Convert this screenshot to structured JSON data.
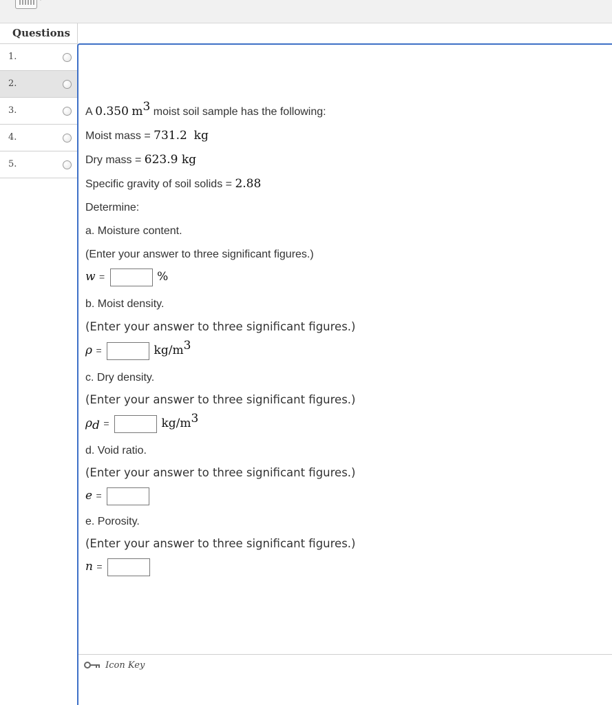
{
  "sidebar": {
    "header": "Questions",
    "items": [
      {
        "label": "1."
      },
      {
        "label": "2."
      },
      {
        "label": "3."
      },
      {
        "label": "4."
      },
      {
        "label": "5."
      }
    ]
  },
  "problem": {
    "intro_a": "A",
    "volume": "0.350",
    "volume_unit": "m",
    "volume_exp": "3",
    "intro_b": "moist soil sample has the following:",
    "moist_mass_label": "Moist mass =",
    "moist_mass_value": "731.2",
    "moist_mass_unit": "kg",
    "dry_mass_label": "Dry mass =",
    "dry_mass_value": "623.9 kg",
    "sg_label": "Specific gravity of soil solids =",
    "sg_value": "2.88",
    "determine": "Determine:"
  },
  "parts": [
    {
      "label": "a. Moisture content.",
      "instruction": "(Enter your answer to three significant figures.)",
      "var": "w",
      "sub": "",
      "eq": "=",
      "unit": "%",
      "unit_exp": "",
      "value": ""
    },
    {
      "label": "b. Moist density.",
      "instruction": "(Enter your answer to three significant figures.)",
      "var": "ρ",
      "sub": "",
      "eq": "=",
      "unit": "kg/m",
      "unit_exp": "3",
      "value": ""
    },
    {
      "label": "c. Dry density.",
      "instruction": "(Enter your answer to three significant figures.)",
      "var": "ρ",
      "sub": "d",
      "eq": "=",
      "unit": "kg/m",
      "unit_exp": "3",
      "value": ""
    },
    {
      "label": "d. Void ratio.",
      "instruction": "(Enter your answer to three significant figures.)",
      "var": "e",
      "sub": "",
      "eq": "=",
      "unit": "",
      "unit_exp": "",
      "value": ""
    },
    {
      "label": "e. Porosity.",
      "instruction": "(Enter your answer to three significant figures.)",
      "var": "n",
      "sub": "",
      "eq": "=",
      "unit": "",
      "unit_exp": "",
      "value": ""
    }
  ],
  "footer": {
    "icon_key": "Icon Key"
  },
  "icons": {
    "toolbar": "keyboard-icon",
    "footer": "key-icon"
  }
}
